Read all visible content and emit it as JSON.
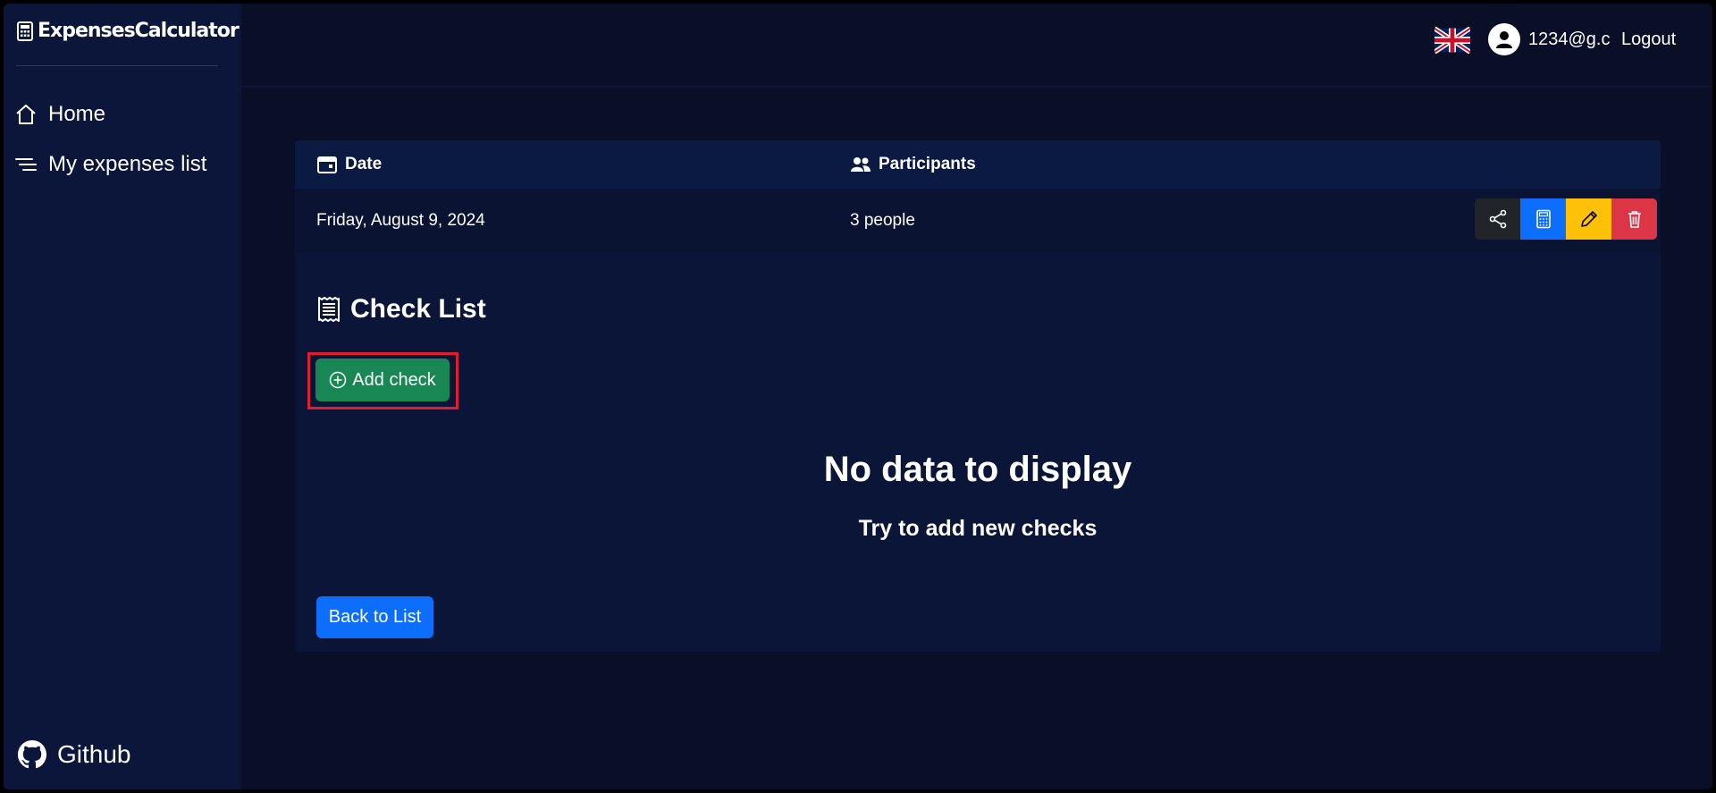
{
  "sidebar": {
    "brand": "ExpensesCalculator",
    "items": [
      {
        "label": "Home",
        "icon": "home-icon"
      },
      {
        "label": "My expenses list",
        "icon": "list-icon"
      }
    ],
    "github_label": "Github"
  },
  "header": {
    "language_icon": "uk-flag-icon",
    "user_email": "1234@g.c",
    "logout_label": "Logout"
  },
  "table": {
    "columns": [
      {
        "label": "Date",
        "icon": "calendar-icon"
      },
      {
        "label": "Participants",
        "icon": "people-icon"
      }
    ],
    "row": {
      "date": "Friday, August 9, 2024",
      "participants": "3 people",
      "actions": [
        {
          "name": "share",
          "icon": "share-icon",
          "color": "#212529"
        },
        {
          "name": "calculate",
          "icon": "calculator-icon",
          "color": "#0d6efd"
        },
        {
          "name": "edit",
          "icon": "pencil-icon",
          "color": "#ffc107"
        },
        {
          "name": "delete",
          "icon": "trash-icon",
          "color": "#dc3545"
        }
      ]
    }
  },
  "checks": {
    "title": "Check List",
    "add_label": "Add check",
    "empty_title": "No data to display",
    "empty_subtitle": "Try to add new checks",
    "back_label": "Back to List"
  },
  "colors": {
    "background": "#090f26",
    "sidebar": "#0b163a",
    "card": "#0b1537",
    "success": "#198754",
    "primary": "#0d6efd",
    "highlight": "#e11d2f"
  }
}
